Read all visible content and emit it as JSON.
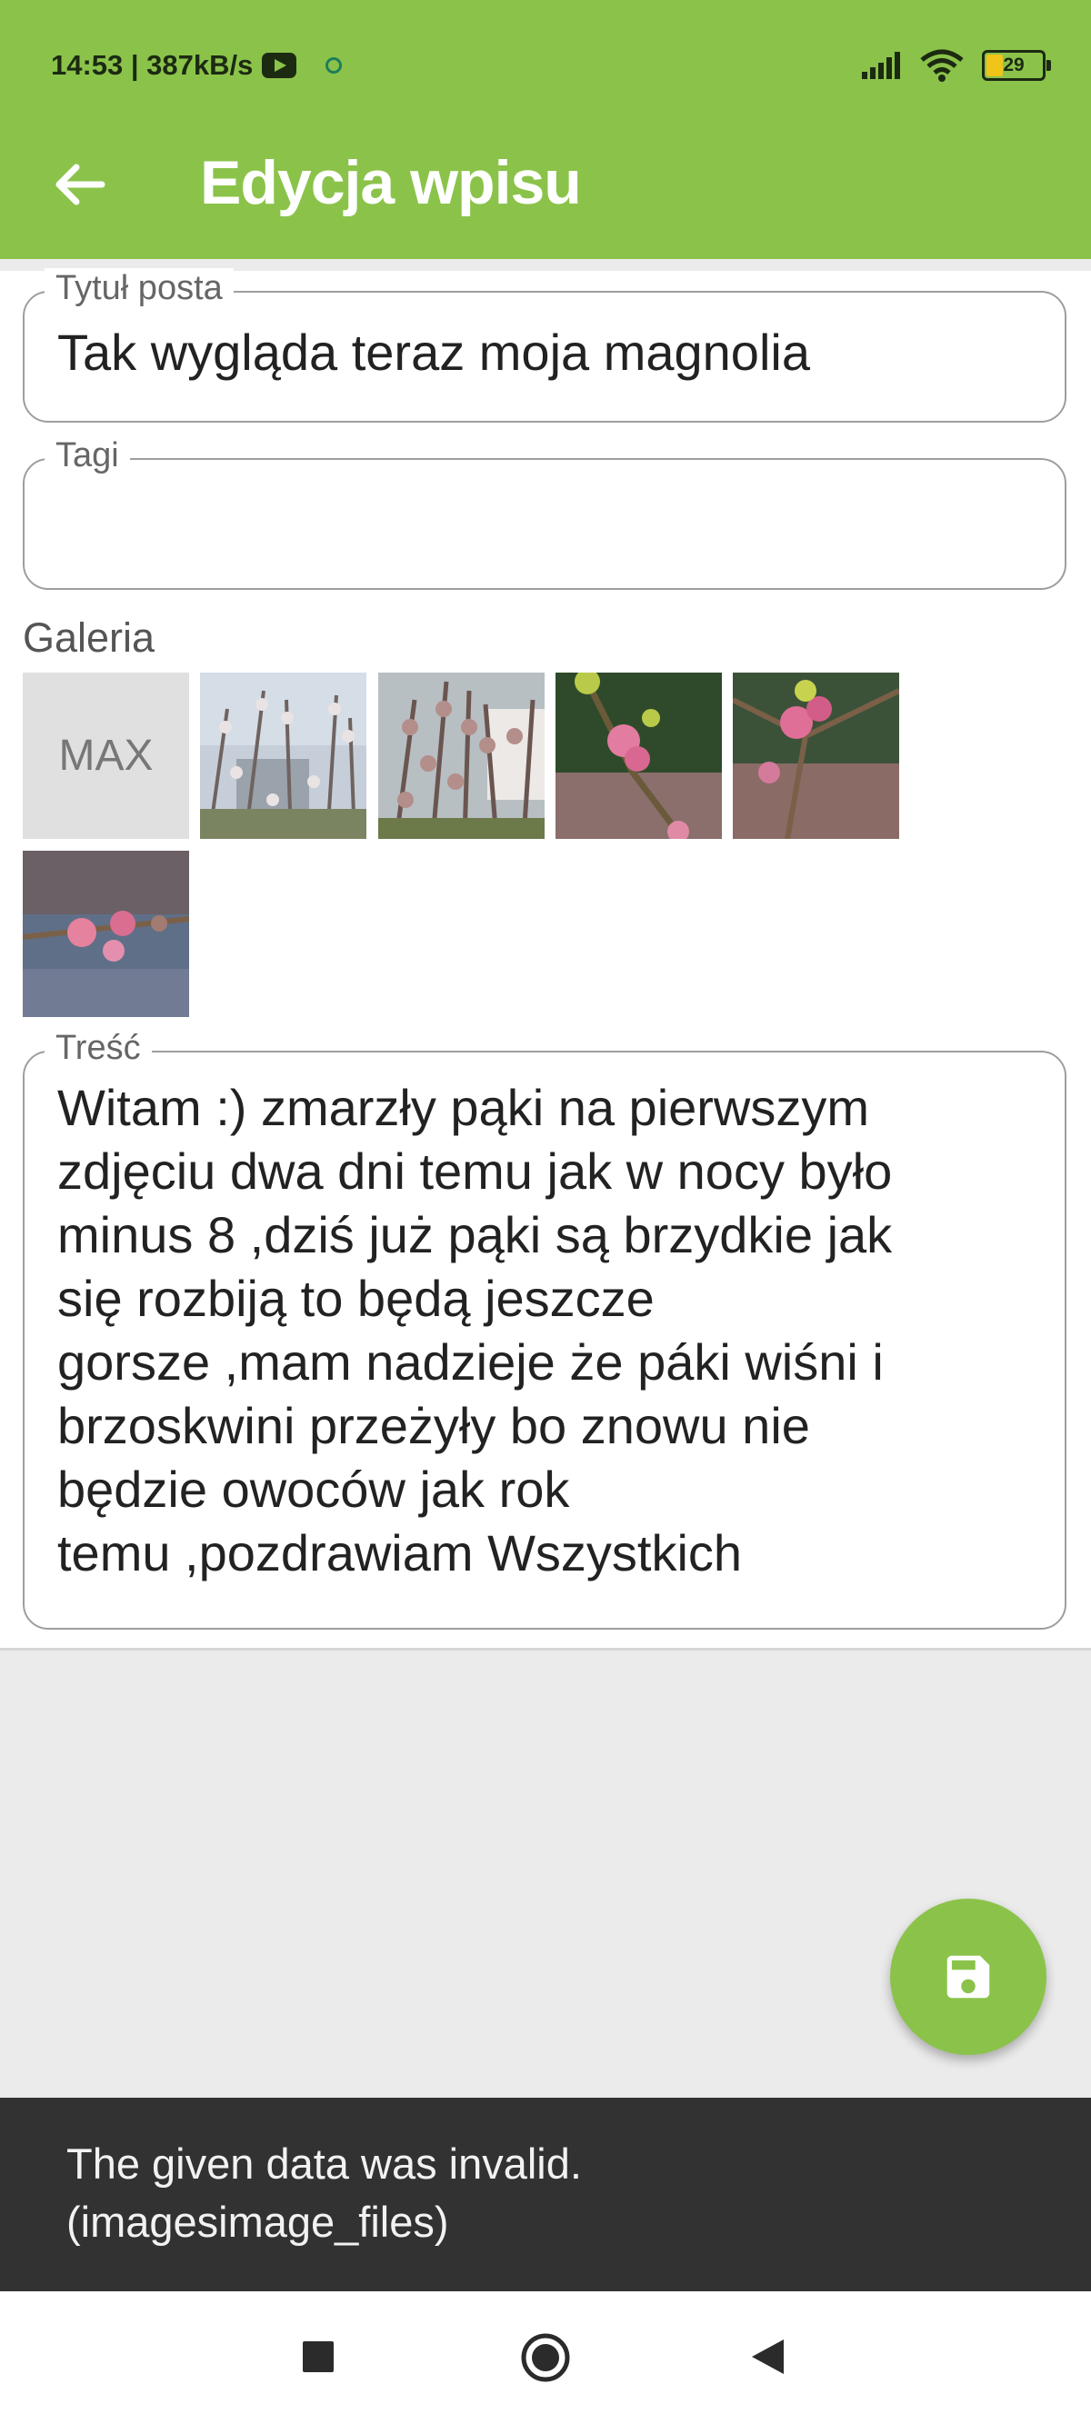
{
  "status_bar": {
    "time_speed": "14:53 | 387kB/s",
    "battery": "29"
  },
  "app_bar": {
    "title": "Edycja wpisu"
  },
  "form": {
    "title_field": {
      "label": "Tytuł posta",
      "value": "Tak wygląda teraz moja magnolia"
    },
    "tags_field": {
      "label": "Tagi",
      "value": ""
    },
    "gallery": {
      "label": "Galeria",
      "max_tile": "MAX"
    },
    "content_field": {
      "label": "Treść",
      "lines": [
        "Witam :) zmarzły pąki na pierwszym",
        "zdjęciu dwa dni temu jak w nocy było",
        "minus 8 ,dziś już pąki są brzydkie jak",
        "się rozbiją to będą jeszcze",
        "gorsze ,mam nadzieje że páki wiśni i",
        "brzoskwini przeżyły bo znowu nie",
        "będzie owoców jak rok",
        "temu ,pozdrawiam Wszystkich"
      ]
    }
  },
  "snackbar": {
    "line1": "The given data was invalid.",
    "line2": "(imagesimage_files)"
  },
  "colors": {
    "primary": "#8bc34a",
    "snackbar": "#323232",
    "screen_bg": "#ebebeb"
  }
}
